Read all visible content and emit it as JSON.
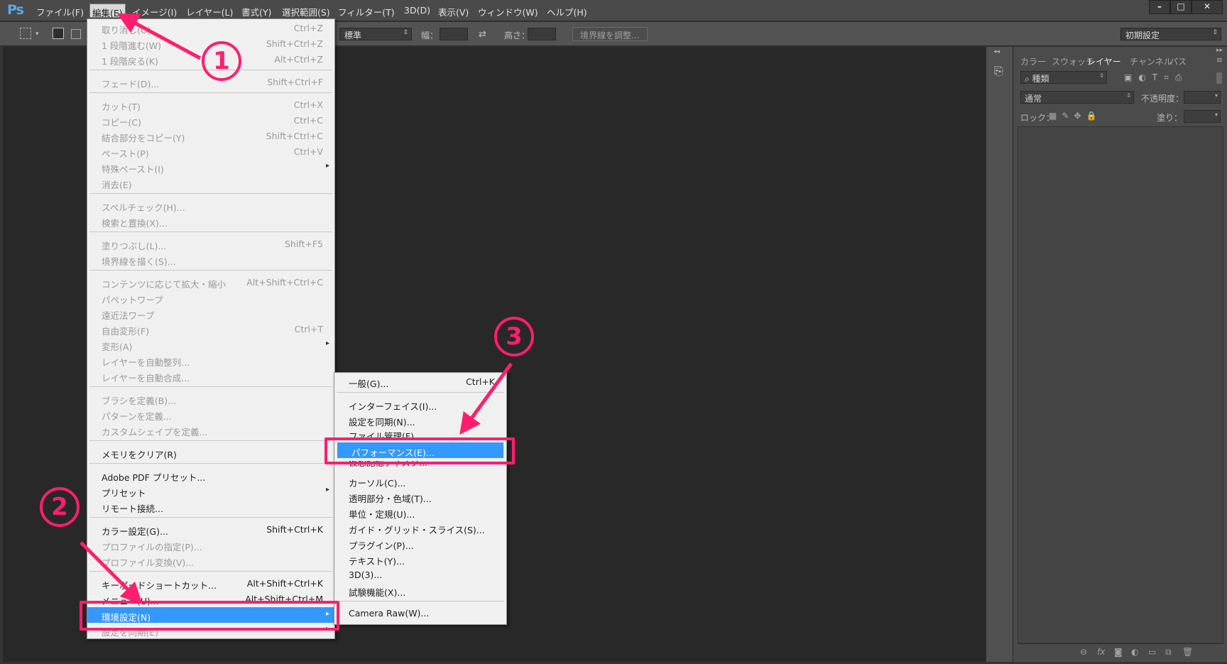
{
  "menubar": {
    "logo": "Ps",
    "items": [
      "ファイル(F)",
      "編集(E)",
      "イメージ(I)",
      "レイヤー(L)",
      "書式(Y)",
      "選択範囲(S)",
      "フィルター(T)",
      "3D(D)",
      "表示(V)",
      "ウィンドウ(W)",
      "ヘルプ(H)"
    ],
    "window_controls": [
      "–",
      "□",
      "✕"
    ]
  },
  "options_bar": {
    "style_select": "標準",
    "width_label": "幅：",
    "height_label": "高さ：",
    "refine_edge_button": "境界線を調整...",
    "workspace_select": "初期設定"
  },
  "layers_panel": {
    "tabs": [
      "カラー",
      "スウォッチ",
      "レイヤー",
      "チャンネル",
      "パス"
    ],
    "filter_kind": "種類",
    "blend_mode": "通常",
    "opacity_label": "不透明度：",
    "lock_label": "ロック：",
    "fill_label": "塗り："
  },
  "edit_menu": {
    "items": [
      {
        "label": "取り消し(O)",
        "shortcut": "Ctrl+Z",
        "enabled": false
      },
      {
        "label": "1 段階進む(W)",
        "shortcut": "Shift+Ctrl+Z",
        "enabled": false
      },
      {
        "label": "1 段階戻る(K)",
        "shortcut": "Alt+Ctrl+Z",
        "enabled": false
      },
      {
        "label": "フェード(D)...",
        "shortcut": "Shift+Ctrl+F",
        "enabled": false
      },
      {
        "label": "カット(T)",
        "shortcut": "Ctrl+X",
        "enabled": false
      },
      {
        "label": "コピー(C)",
        "shortcut": "Ctrl+C",
        "enabled": false
      },
      {
        "label": "結合部分をコピー(Y)",
        "shortcut": "Shift+Ctrl+C",
        "enabled": false
      },
      {
        "label": "ペースト(P)",
        "shortcut": "Ctrl+V",
        "enabled": false
      },
      {
        "label": "特殊ペースト(I)",
        "shortcut": "",
        "enabled": false,
        "submenu": true
      },
      {
        "label": "消去(E)",
        "shortcut": "",
        "enabled": false
      },
      {
        "label": "スペルチェック(H)...",
        "shortcut": "",
        "enabled": false
      },
      {
        "label": "検索と置換(X)...",
        "shortcut": "",
        "enabled": false
      },
      {
        "label": "塗りつぶし(L)...",
        "shortcut": "Shift+F5",
        "enabled": false
      },
      {
        "label": "境界線を描く(S)...",
        "shortcut": "",
        "enabled": false
      },
      {
        "label": "コンテンツに応じて拡大・縮小",
        "shortcut": "Alt+Shift+Ctrl+C",
        "enabled": false
      },
      {
        "label": "パペットワープ",
        "shortcut": "",
        "enabled": false
      },
      {
        "label": "遠近法ワープ",
        "shortcut": "",
        "enabled": false
      },
      {
        "label": "自由変形(F)",
        "shortcut": "Ctrl+T",
        "enabled": false
      },
      {
        "label": "変形(A)",
        "shortcut": "",
        "enabled": false,
        "submenu": true
      },
      {
        "label": "レイヤーを自動整列...",
        "shortcut": "",
        "enabled": false
      },
      {
        "label": "レイヤーを自動合成...",
        "shortcut": "",
        "enabled": false
      },
      {
        "label": "ブラシを定義(B)...",
        "shortcut": "",
        "enabled": false
      },
      {
        "label": "パターンを定義...",
        "shortcut": "",
        "enabled": false
      },
      {
        "label": "カスタムシェイプを定義...",
        "shortcut": "",
        "enabled": false
      },
      {
        "label": "メモリをクリア(R)",
        "shortcut": "",
        "enabled": true
      },
      {
        "label": "Adobe PDF プリセット...",
        "shortcut": "",
        "enabled": true
      },
      {
        "label": "プリセット",
        "shortcut": "",
        "enabled": true,
        "submenu": true
      },
      {
        "label": "リモート接続...",
        "shortcut": "",
        "enabled": true
      },
      {
        "label": "カラー設定(G)...",
        "shortcut": "Shift+Ctrl+K",
        "enabled": true
      },
      {
        "label": "プロファイルの指定(P)...",
        "shortcut": "",
        "enabled": false
      },
      {
        "label": "プロファイル変換(V)...",
        "shortcut": "",
        "enabled": false
      },
      {
        "label": "キーボードショートカット...",
        "shortcut": "Alt+Shift+Ctrl+K",
        "enabled": true
      },
      {
        "label": "メニュー(U)...",
        "shortcut": "Alt+Shift+Ctrl+M",
        "enabled": true
      },
      {
        "label": "環境設定(N)",
        "shortcut": "",
        "enabled": true,
        "submenu": true,
        "highlighted": true
      },
      {
        "label": "設定を同期(E)",
        "shortcut": "",
        "enabled": false,
        "submenu": true
      }
    ]
  },
  "preferences_submenu": {
    "items": [
      {
        "label": "一般(G)...",
        "shortcut": "Ctrl+K"
      },
      {
        "label": "インターフェイス(I)...",
        "shortcut": ""
      },
      {
        "label": "設定を同期(N)...",
        "shortcut": ""
      },
      {
        "label": "ファイル管理(F)...",
        "shortcut": ""
      },
      {
        "label": "パフォーマンス(E)...",
        "shortcut": "",
        "highlighted": true
      },
      {
        "label": "仮想記憶ディスク...",
        "shortcut": ""
      },
      {
        "label": "カーソル(C)...",
        "shortcut": ""
      },
      {
        "label": "透明部分・色域(T)...",
        "shortcut": ""
      },
      {
        "label": "単位・定規(U)...",
        "shortcut": ""
      },
      {
        "label": "ガイド・グリッド・スライス(S)...",
        "shortcut": ""
      },
      {
        "label": "プラグイン(P)...",
        "shortcut": ""
      },
      {
        "label": "テキスト(Y)...",
        "shortcut": ""
      },
      {
        "label": "3D(3)...",
        "shortcut": ""
      },
      {
        "label": "試験機能(X)...",
        "shortcut": ""
      },
      {
        "label": "Camera Raw(W)...",
        "shortcut": ""
      }
    ]
  },
  "annotations": {
    "step1": "1",
    "step2": "2",
    "step3": "3",
    "accent_color": "#ff1e6e",
    "highlight_color": "#3399ff"
  }
}
